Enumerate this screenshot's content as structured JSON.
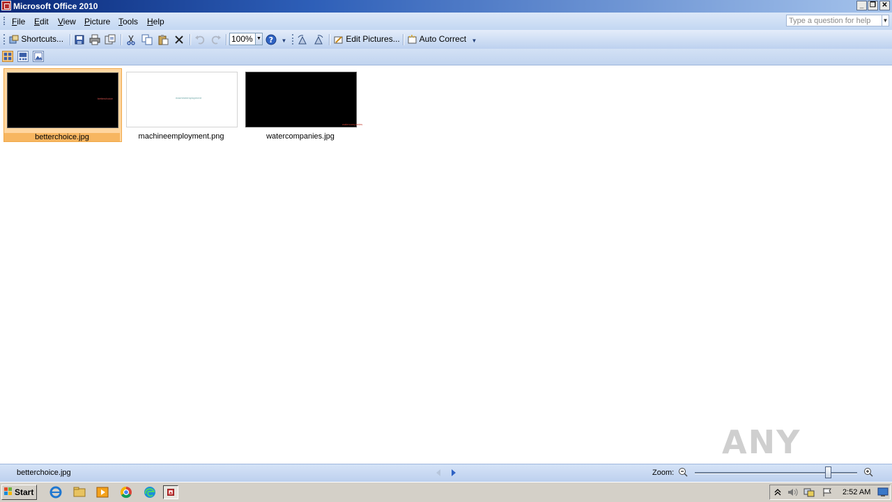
{
  "window": {
    "title": "Microsoft Office 2010"
  },
  "menu": {
    "items": [
      {
        "label": "File",
        "key": "F",
        "rest": "ile"
      },
      {
        "label": "Edit",
        "key": "E",
        "rest": "dit"
      },
      {
        "label": "View",
        "key": "V",
        "rest": "iew"
      },
      {
        "label": "Picture",
        "key": "P",
        "rest": "icture"
      },
      {
        "label": "Tools",
        "key": "T",
        "rest": "ools"
      },
      {
        "label": "Help",
        "key": "H",
        "rest": "elp"
      }
    ],
    "help_placeholder": "Type a question for help"
  },
  "toolbar": {
    "shortcuts_label": "Shortcuts...",
    "zoom_value": "100%",
    "edit_pictures_label": "Edit Pictures...",
    "auto_correct_label": "Auto Correct"
  },
  "thumbnails": [
    {
      "filename": "betterchoice.jpg",
      "bg": "black",
      "overlay_text": "betterchoice",
      "overlay_color": "#d9534f",
      "selected": true
    },
    {
      "filename": "machineemployment.png",
      "bg": "white",
      "overlay_text": "machineemployment",
      "overlay_color": "#6fa8a8",
      "selected": false
    },
    {
      "filename": "watercompanies.jpg",
      "bg": "black",
      "overlay_text": "watercompanies",
      "overlay_color": "#c0392b",
      "selected": false
    }
  ],
  "status": {
    "current_file": "betterchoice.jpg",
    "zoom_label": "Zoom:"
  },
  "taskbar": {
    "start_label": "Start",
    "time": "2:52 AM"
  },
  "watermark": "ANY RUN",
  "colors": {
    "title_start": "#0a2a7a",
    "selection": "#f7b661",
    "menubar": "#c3d7f2"
  }
}
